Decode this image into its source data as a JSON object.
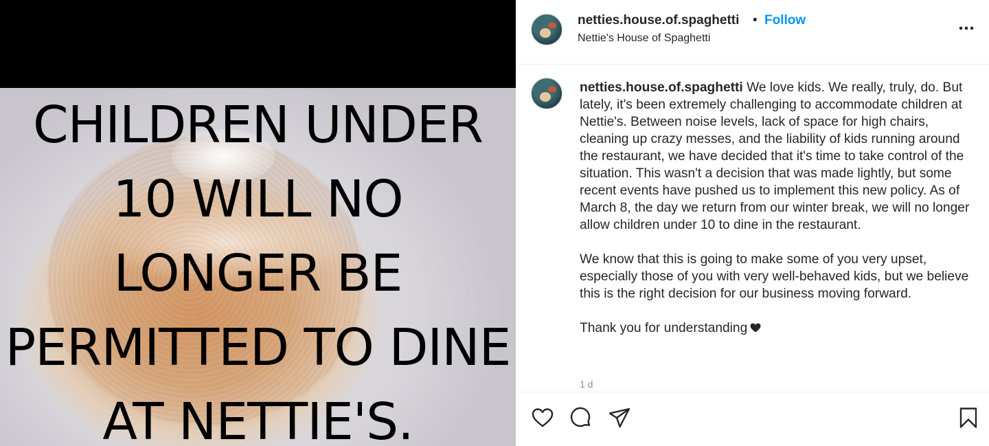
{
  "post_image": {
    "headline_lines": [
      "CHILDREN UNDER",
      "10 WILL NO",
      "LONGER BE",
      "PERMITTED TO DINE",
      "AT NETTIE'S."
    ]
  },
  "header": {
    "username": "netties.house.of.spaghetti",
    "separator": "•",
    "follow_label": "Follow",
    "display_name": "Nettie's House of Spaghetti",
    "more_icon": "more-horizontal-icon"
  },
  "caption": {
    "username": "netties.house.of.spaghetti",
    "paragraph_1": "We love kids. We really, truly, do. But lately, it's been extremely challenging to accommodate children at Nettie's. Between noise levels, lack of space for high chairs, cleaning up crazy messes, and the liability of kids running around the restaurant, we have decided that it's time to take control of the situation. This wasn't a decision that was made lightly, but some recent events have pushed us to implement this new policy. As of March 8, the day we return from our winter break, we will no longer allow children under 10 to dine in the restaurant.",
    "paragraph_2": "We know that this is going to make some of you very upset, especially those of you with very well-behaved kids, but we believe this is the right decision for our business moving forward.",
    "paragraph_3": "Thank you for understanding",
    "heart_icon": "black-heart-icon",
    "timestamp": "1 d"
  },
  "actions": {
    "like_icon": "heart-outline-icon",
    "comment_icon": "comment-bubble-icon",
    "share_icon": "paper-plane-icon",
    "save_icon": "bookmark-icon"
  },
  "colors": {
    "follow_blue": "#0095f6",
    "text": "#262626",
    "muted": "#8e8e8e",
    "divider": "#efefef"
  }
}
